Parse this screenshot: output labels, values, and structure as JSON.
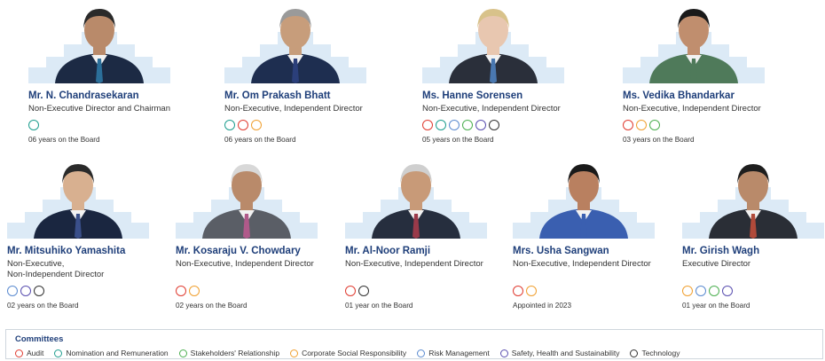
{
  "colors": {
    "audit": "#e03c31",
    "nomination": "#1f9e8f",
    "stakeholders": "#4caf50",
    "csr": "#f0a030",
    "risk": "#5b8bd0",
    "safety": "#5a4fb0",
    "technology": "#333333",
    "name": "#1f3f7a",
    "stair": "#dceaf6"
  },
  "directors": [
    {
      "name": "Mr. N. Chandrasekaran",
      "role1": "Non-Executive Director and Chairman",
      "role2": "",
      "committees": [
        "nomination"
      ],
      "years": "06 years on the Board",
      "suit": "#1c2a44",
      "skin": "#b98a6a",
      "hair": "#2a2a2a",
      "tie": "#2b6f9a"
    },
    {
      "name": "Mr. Om Prakash Bhatt",
      "role1": "Non-Executive, Independent Director",
      "role2": "",
      "committees": [
        "nomination",
        "audit",
        "csr"
      ],
      "years": "06 years on the Board",
      "suit": "#1e2e50",
      "skin": "#c79d7b",
      "hair": "#9a9a9a",
      "tie": "#2b3f7a"
    },
    {
      "name": "Ms. Hanne Sorensen",
      "role1": "Non-Executive, Independent Director",
      "role2": "",
      "committees": [
        "audit",
        "nomination",
        "risk",
        "stakeholders",
        "safety",
        "technology"
      ],
      "years": "05 years on the Board",
      "suit": "#2a2f3a",
      "skin": "#e8c7b0",
      "hair": "#d8c28a",
      "tie": "#4a78b0"
    },
    {
      "name": "Ms. Vedika Bhandarkar",
      "role1": "Non-Executive, Independent Director",
      "role2": "",
      "committees": [
        "audit",
        "csr",
        "stakeholders"
      ],
      "years": "03 years on the Board",
      "suit": "#4f7a5a",
      "skin": "#c08e6e",
      "hair": "#1a1a1a",
      "tie": "#4f7a5a"
    },
    {
      "name": "Mr. Mitsuhiko Yamashita",
      "role1": "Non-Executive,",
      "role2": "Non-Independent Director",
      "committees": [
        "risk",
        "safety",
        "technology"
      ],
      "years": "02 years on the Board",
      "suit": "#1a2640",
      "skin": "#d8b090",
      "hair": "#2a2a2a",
      "tie": "#3a4f8a"
    },
    {
      "name": "Mr. Kosaraju V. Chowdary",
      "role1": "Non-Executive, Independent Director",
      "role2": "",
      "committees": [
        "audit",
        "csr"
      ],
      "years": "02 years on the Board",
      "suit": "#5a5e66",
      "skin": "#b98a6a",
      "hair": "#d8d8d8",
      "tie": "#b05a8a"
    },
    {
      "name": "Mr. Al-Noor Ramji",
      "role1": "Non-Executive, Independent Director",
      "role2": "",
      "committees": [
        "audit",
        "technology"
      ],
      "years": "01 year on the Board",
      "suit": "#262e3e",
      "skin": "#c89a78",
      "hair": "#cfcfcf",
      "tie": "#9a3a4a"
    },
    {
      "name": "Mrs. Usha Sangwan",
      "role1": "Non-Executive, Independent Director",
      "role2": "",
      "committees": [
        "audit",
        "csr"
      ],
      "years": "Appointed in 2023",
      "suit": "#3a5fb0",
      "skin": "#b98060",
      "hair": "#1a1a1a",
      "tie": "#3a5fb0"
    },
    {
      "name": "Mr. Girish Wagh",
      "role1": "Executive Director",
      "role2": "",
      "committees": [
        "csr",
        "risk",
        "stakeholders",
        "safety"
      ],
      "years": "01 year on the Board",
      "suit": "#2a2e36",
      "skin": "#b98a6a",
      "hair": "#1e1e1e",
      "tie": "#b04a3a"
    }
  ],
  "legend": {
    "title": "Committees",
    "items": [
      {
        "key": "audit",
        "label": "Audit"
      },
      {
        "key": "nomination",
        "label": "Nomination and Remuneration"
      },
      {
        "key": "stakeholders",
        "label": "Stakeholders' Relationship"
      },
      {
        "key": "csr",
        "label": "Corporate Social Responsibility"
      },
      {
        "key": "risk",
        "label": "Risk Management"
      },
      {
        "key": "safety",
        "label": "Safety, Health and Sustainability"
      },
      {
        "key": "technology",
        "label": "Technology"
      }
    ]
  }
}
